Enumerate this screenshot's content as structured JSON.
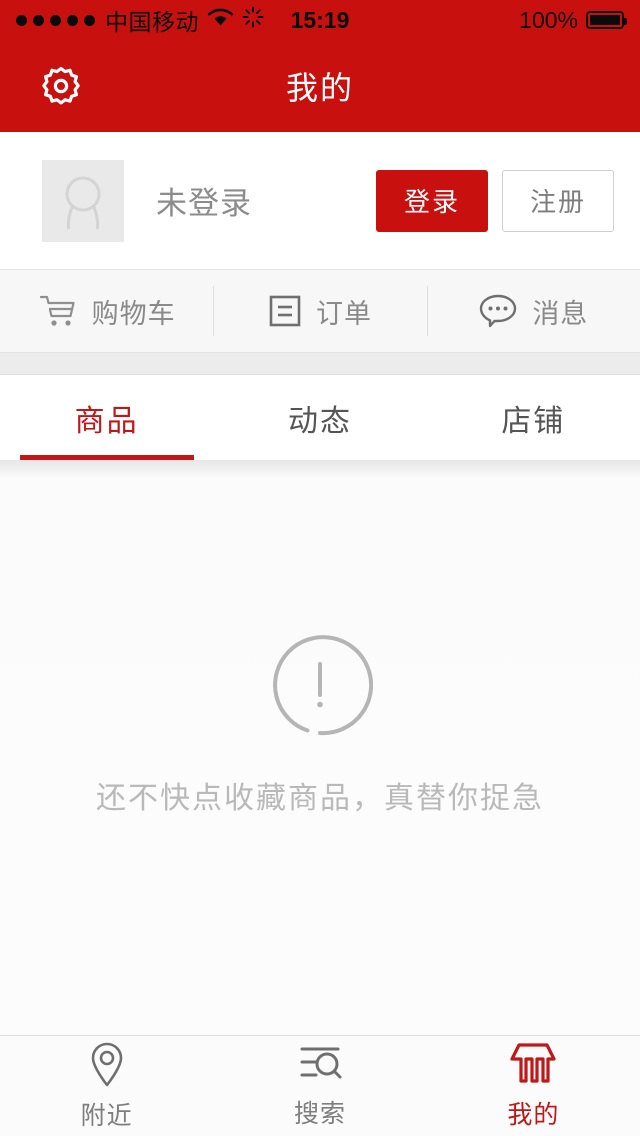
{
  "statusbar": {
    "signal_dots": 5,
    "carrier": "中国移动",
    "wifi_icon": "wifi-icon",
    "sync_icon": "sync-spinner-icon",
    "time": "15:19",
    "battery_percent": "100%",
    "battery_icon": "battery-full-icon"
  },
  "header": {
    "settings_icon": "gear-icon",
    "title": "我的",
    "background_color": "#c8110f"
  },
  "profile": {
    "avatar_icon": "user-avatar-placeholder-icon",
    "status_text": "未登录",
    "login_label": "登录",
    "register_label": "注册",
    "login_color": "#c8110f"
  },
  "quick_actions": [
    {
      "icon": "shopping-cart-icon",
      "label": "购物车"
    },
    {
      "icon": "order-list-icon",
      "label": "订单"
    },
    {
      "icon": "message-bubble-icon",
      "label": "消息"
    }
  ],
  "tabs": {
    "items": [
      {
        "label": "商品",
        "active": true
      },
      {
        "label": "动态",
        "active": false
      },
      {
        "label": "店铺",
        "active": false
      }
    ],
    "active_color": "#c01818"
  },
  "empty_state": {
    "icon": "exclamation-circle-icon",
    "message": "还不快点收藏商品，真替你捉急"
  },
  "tabbar": {
    "items": [
      {
        "icon": "location-pin-icon",
        "label": "附近",
        "active": false
      },
      {
        "icon": "search-list-icon",
        "label": "搜索",
        "active": false
      },
      {
        "icon": "storefront-icon",
        "label": "我的",
        "active": true
      }
    ],
    "active_color": "#c01818"
  }
}
